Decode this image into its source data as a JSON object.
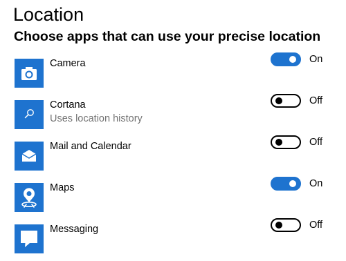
{
  "page": {
    "title": "Location",
    "heading": "Choose apps that can use your precise location"
  },
  "colors": {
    "accent": "#1e73cf",
    "secondary_text": "#737373"
  },
  "apps": [
    {
      "name": "Camera",
      "subtitle": "",
      "icon": "camera-icon",
      "toggle_state": true,
      "toggle_label": "On"
    },
    {
      "name": "Cortana",
      "subtitle": "Uses location history",
      "icon": "search-icon",
      "toggle_state": false,
      "toggle_label": "Off"
    },
    {
      "name": "Mail and Calendar",
      "subtitle": "",
      "icon": "envelope-icon",
      "toggle_state": false,
      "toggle_label": "Off"
    },
    {
      "name": "Maps",
      "subtitle": "",
      "icon": "map-pin-icon",
      "toggle_state": true,
      "toggle_label": "On"
    },
    {
      "name": "Messaging",
      "subtitle": "",
      "icon": "speech-bubble-icon",
      "toggle_state": false,
      "toggle_label": "Off"
    }
  ]
}
